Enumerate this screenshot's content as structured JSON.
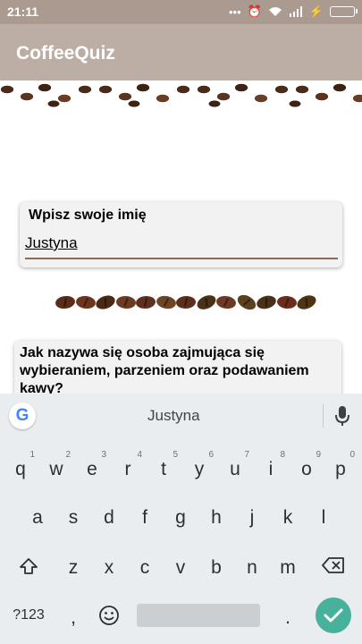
{
  "status_bar": {
    "time": "21:11",
    "icons": [
      "more-icon",
      "alarm-icon",
      "wifi-icon",
      "signal-icon",
      "charging-icon",
      "battery-icon"
    ]
  },
  "app_bar": {
    "title": "CoffeeQuiz"
  },
  "name_card": {
    "label": "Wpisz swoje imię",
    "value": "Justyna"
  },
  "question_card": {
    "text": "Jak nazywa się osoba zajmująca się wybieraniem, parzeniem oraz podawaniem kawy?"
  },
  "keyboard": {
    "suggestion": "Justyna",
    "row1": [
      {
        "char": "q",
        "hint": "1"
      },
      {
        "char": "w",
        "hint": "2"
      },
      {
        "char": "e",
        "hint": "3"
      },
      {
        "char": "r",
        "hint": "4"
      },
      {
        "char": "t",
        "hint": "5"
      },
      {
        "char": "y",
        "hint": "6"
      },
      {
        "char": "u",
        "hint": "7"
      },
      {
        "char": "i",
        "hint": "8"
      },
      {
        "char": "o",
        "hint": "9"
      },
      {
        "char": "p",
        "hint": "0"
      }
    ],
    "row2": [
      "a",
      "s",
      "d",
      "f",
      "g",
      "h",
      "j",
      "k",
      "l"
    ],
    "row3": [
      "z",
      "x",
      "c",
      "v",
      "b",
      "n",
      "m"
    ],
    "symbols_label": "?123",
    "comma": ",",
    "period": "."
  },
  "colors": {
    "status_bar": "#aa9a8f",
    "app_bar": "#bcaea5",
    "accent": "#48b19c",
    "input_underline": "#8b6a5a"
  }
}
